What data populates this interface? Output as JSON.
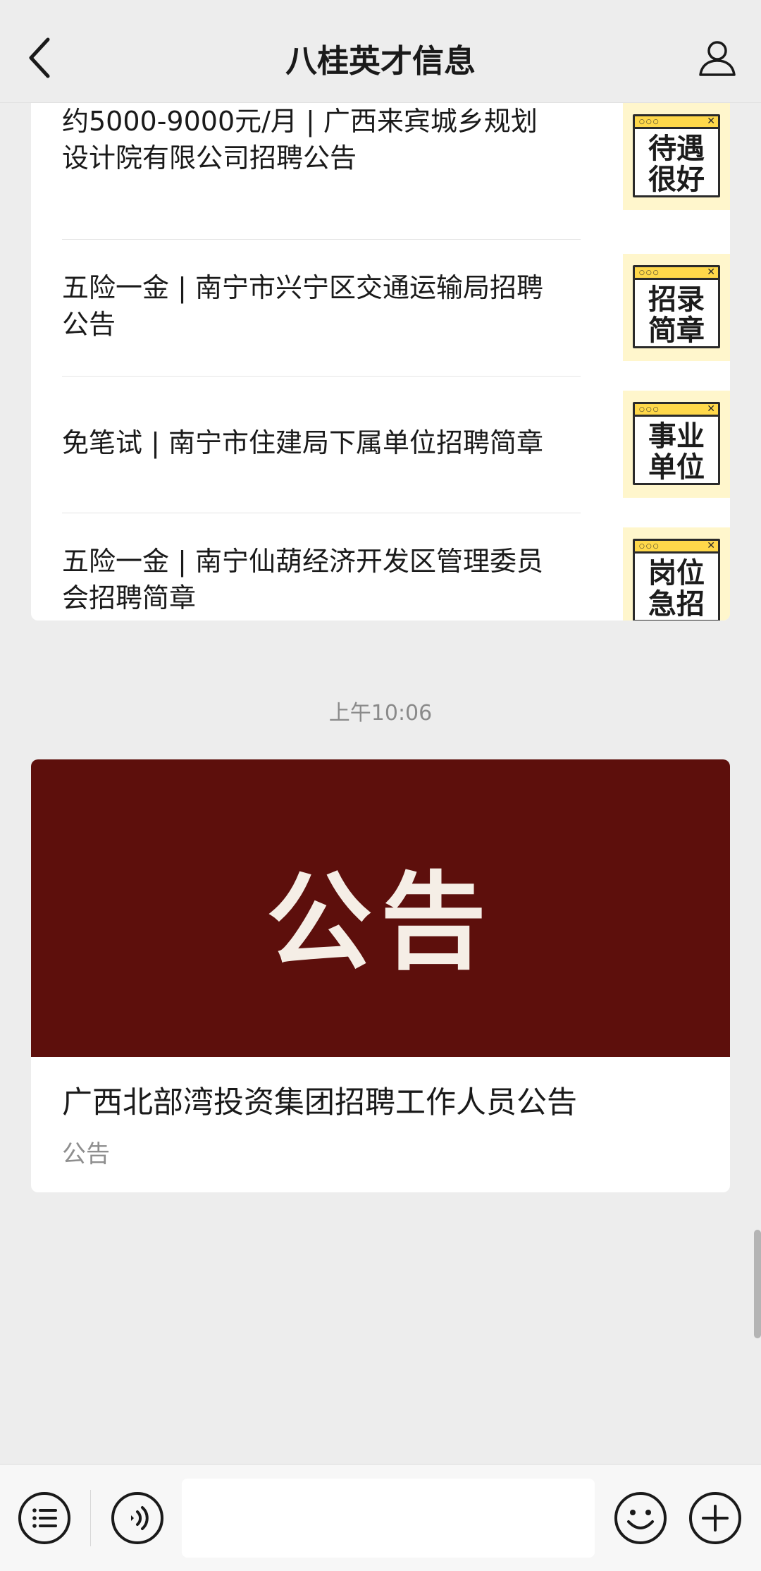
{
  "header": {
    "title": "八桂英才信息",
    "back_icon": "back-arrow-icon",
    "profile_icon": "person-icon"
  },
  "articles": [
    {
      "title_line1": "约5000-9000元/月 | 广西来宾城乡规划",
      "title_line2": "设计院有限公司招聘公告",
      "thumb_line1": "待遇",
      "thumb_line2": "很好"
    },
    {
      "title_line1": "五险一金 | 南宁市兴宁区交通运输局招聘",
      "title_line2": "公告",
      "thumb_line1": "招录",
      "thumb_line2": "简章"
    },
    {
      "title_line1": "免笔试 | 南宁市住建局下属单位招聘简章",
      "title_line2": "",
      "thumb_line1": "事业",
      "thumb_line2": "单位"
    },
    {
      "title_line1": "五险一金 | 南宁仙葫经济开发区管理委员",
      "title_line2": "会招聘简章",
      "thumb_line1": "岗位",
      "thumb_line2": "急招"
    }
  ],
  "timestamp": "上午10:06",
  "announcement": {
    "banner_text": "公告",
    "title": "广西北部湾投资集团招聘工作人员公告",
    "subtitle": "公告"
  },
  "bottom_bar": {
    "menu_icon": "menu-list-icon",
    "voice_icon": "voice-icon",
    "input_value": "",
    "emoji_icon": "emoji-icon",
    "plus_icon": "plus-icon"
  },
  "colors": {
    "banner": "#5d0f0c",
    "thumb_bg": "#fff6cc",
    "thumb_accent": "#ffd84a"
  }
}
